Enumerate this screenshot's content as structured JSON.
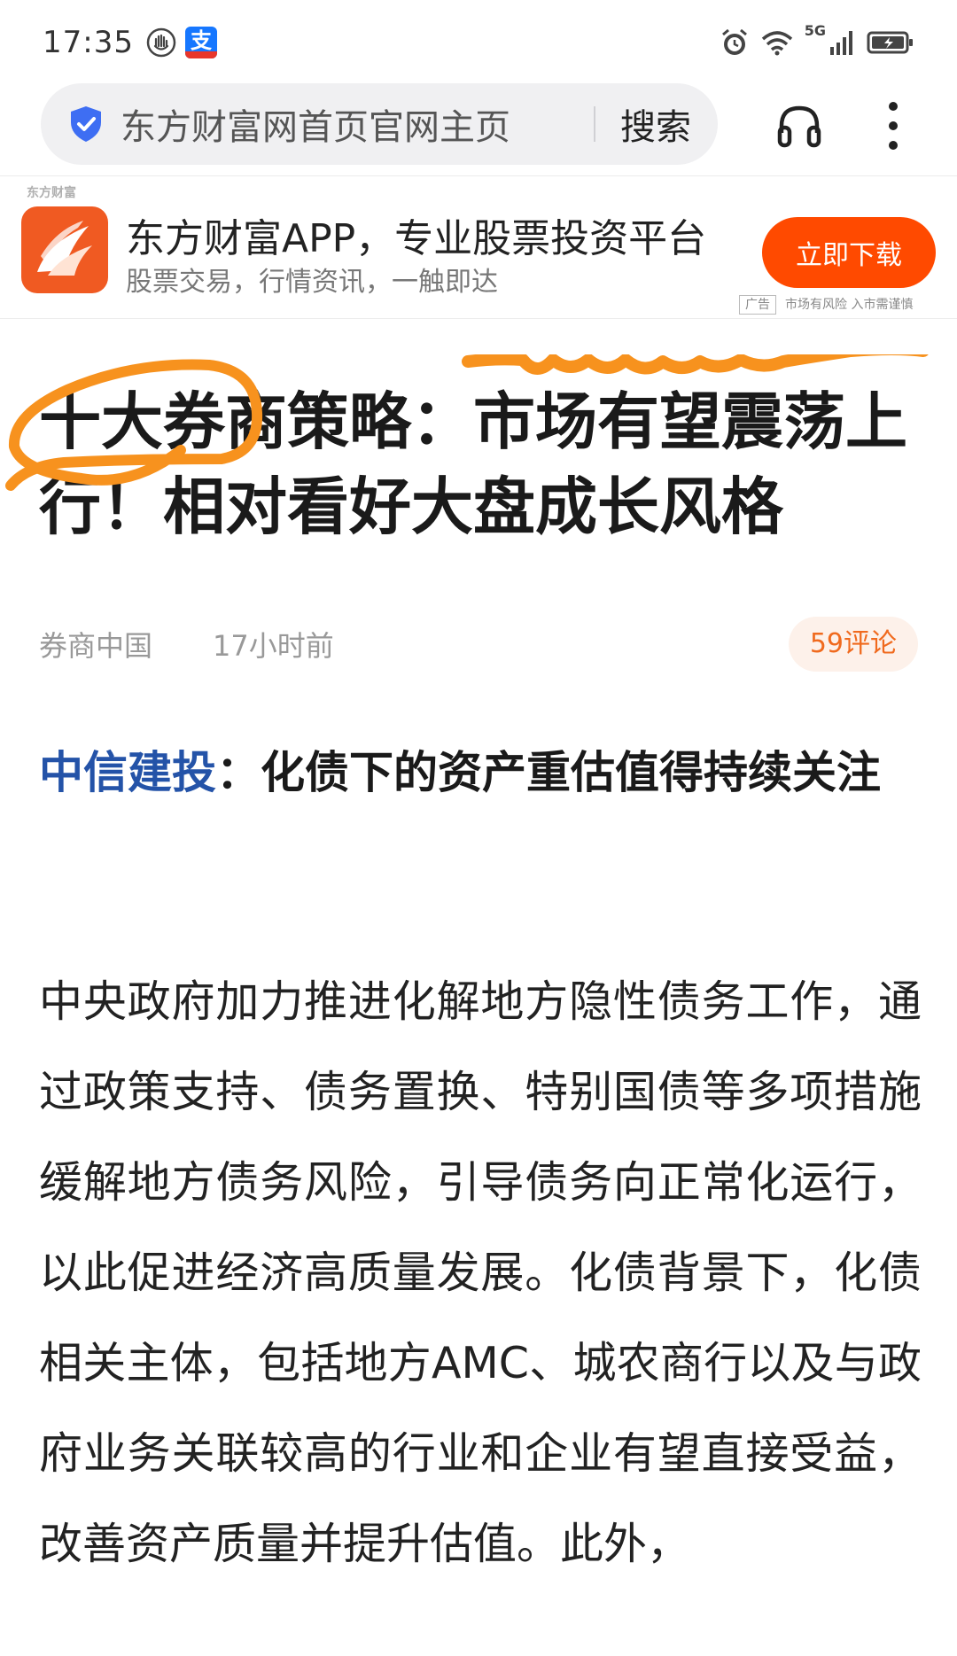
{
  "status_bar": {
    "time": "17:35",
    "alipay_glyph": "支",
    "network_label": "5G"
  },
  "browser": {
    "url_text": "东方财富网首页官网主页",
    "search_label": "搜索"
  },
  "ad": {
    "source_label": "东方财富",
    "title": "东方财富APP，专业股票投资平台",
    "subtitle": "股票交易，行情资讯，一触即达",
    "cta_label": "立即下载",
    "tag": "广告",
    "risk_notice": "市场有风险 入市需谨慎",
    "accent_color": "#ff4a00"
  },
  "article": {
    "headline": "十大券商策略：市场有望震荡上行！相对看好大盘成长风格",
    "source": "券商中国",
    "time_ago": "17小时前",
    "comments": "59评论",
    "section_broker": "中信建投",
    "section_title": "：化债下的资产重估值得持续关注",
    "body": "中央政府加力推进化解地方隐性债务工作，通过政策支持、债务置换、特别国债等多项措施缓解地方债务风险，引导债务向正常化运行，以此促进经济高质量发展。化债背景下，化债相关主体，包括地方AMC、城农商行以及与政府业务关联较高的行业和企业有望直接受益，改善资产质量并提升估值。此外，"
  },
  "colors": {
    "broker_blue": "#2453a8",
    "markup_orange": "#f7921e"
  }
}
